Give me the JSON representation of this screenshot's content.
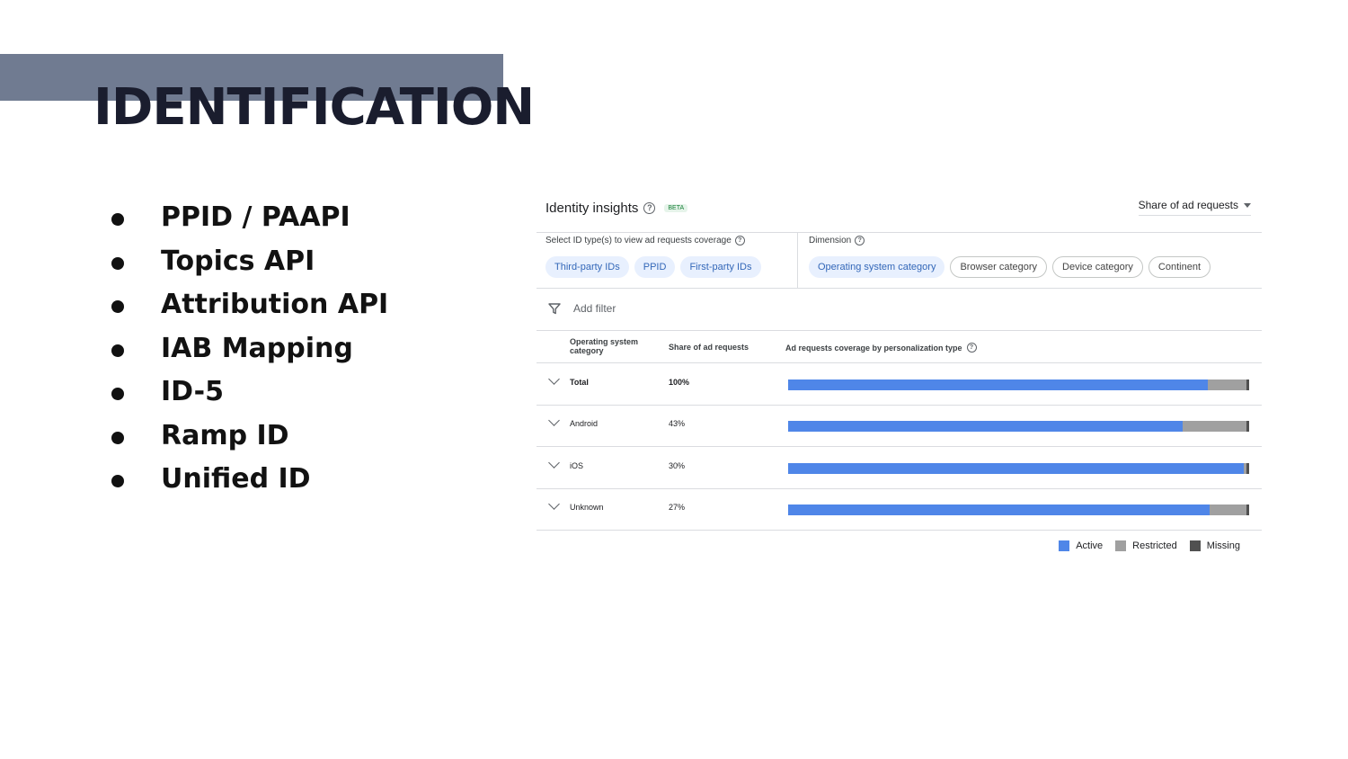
{
  "slide": {
    "title": "IDENTIFICATION",
    "bullets": [
      "PPID / PAAPI",
      "Topics API",
      "Attribution API",
      "IAB Mapping",
      "ID-5",
      "Ramp ID",
      "Unified ID"
    ]
  },
  "panel": {
    "title": "Identity insights",
    "beta": "BETA",
    "metric_select": "Share of ad requests",
    "id_types": {
      "label": "Select ID type(s) to view ad requests coverage",
      "chips": [
        "Third-party IDs",
        "PPID",
        "First-party IDs"
      ]
    },
    "dimension": {
      "label": "Dimension",
      "chips": [
        "Operating system category",
        "Browser category",
        "Device category",
        "Continent"
      ],
      "selected": "Operating system category"
    },
    "filter_label": "Add filter",
    "table": {
      "headers": [
        "Operating system category",
        "Share of ad requests",
        "Ad requests coverage by personalization type"
      ],
      "rows": [
        {
          "category": "Total",
          "share": "100%"
        },
        {
          "category": "Android",
          "share": "43%"
        },
        {
          "category": "iOS",
          "share": "30%"
        },
        {
          "category": "Unknown",
          "share": "27%"
        }
      ]
    }
  },
  "chart_data": {
    "type": "bar",
    "stacked": true,
    "orientation": "horizontal",
    "categories": [
      "Total",
      "Android",
      "iOS",
      "Unknown"
    ],
    "series": [
      {
        "name": "Active",
        "color": "#4f86e8",
        "values": [
          91,
          85.5,
          98.8,
          91.5
        ]
      },
      {
        "name": "Restricted",
        "color": "#a0a0a0",
        "values": [
          8.5,
          14,
          0.6,
          8
        ]
      },
      {
        "name": "Missing",
        "color": "#505050",
        "values": [
          0.5,
          0.5,
          0.6,
          0.5
        ]
      }
    ],
    "xlim": [
      0,
      100
    ]
  }
}
